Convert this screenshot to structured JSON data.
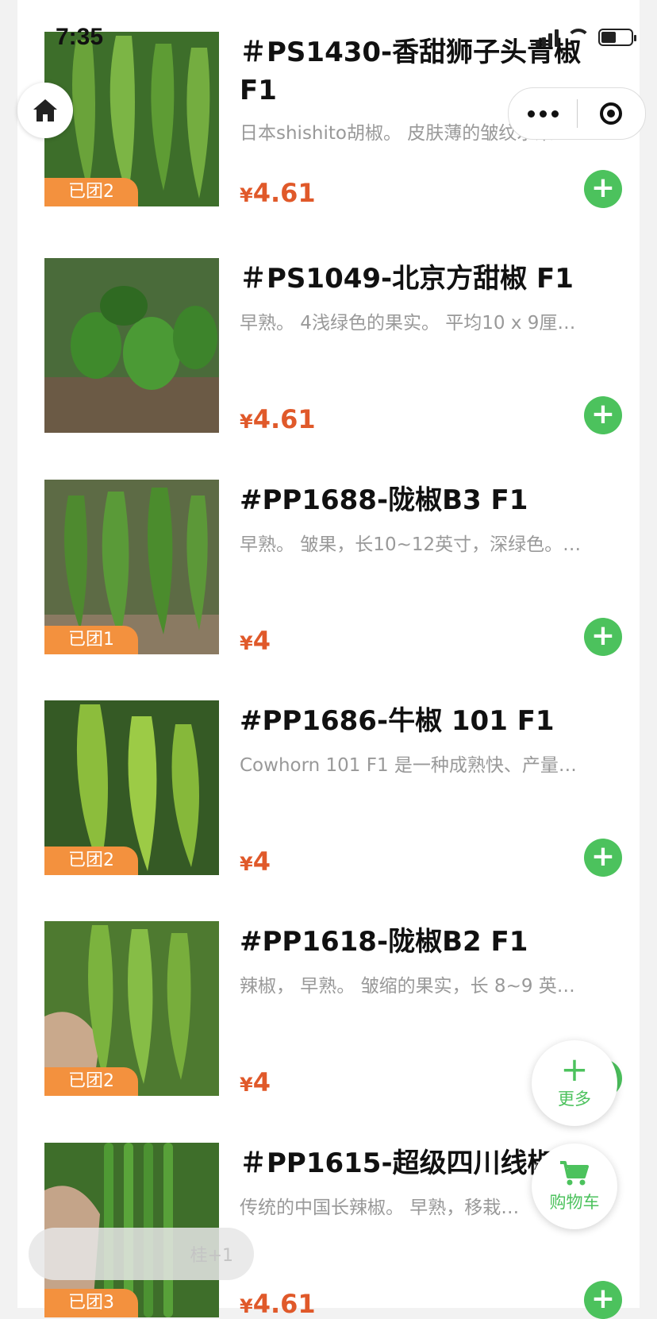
{
  "status_bar": {
    "time": "7:35",
    "battery_icon": "battery-charging-icon",
    "wifi_icon": "wifi-icon"
  },
  "nav": {
    "home_icon": "home-icon",
    "more_icon": "more-dots-icon",
    "close_icon": "target-icon"
  },
  "products": [
    {
      "title": "＃PS1430-香甜狮子头青椒 F1",
      "desc": "日本shishito胡椒。 皮肤薄的皱纹水果…",
      "price_symbol": "¥",
      "price_value": "4.61",
      "badge": "已团2"
    },
    {
      "title": "＃PS1049-北京方甜椒 F1",
      "desc": "早熟。 4浅绿色的果实。 平均10 x 9厘…",
      "price_symbol": "¥",
      "price_value": "4.61",
      "badge": ""
    },
    {
      "title": "#PP1688-陇椒B3 F1",
      "desc": "早熟。 皱果，长10~12英寸，深绿色。…",
      "price_symbol": "¥",
      "price_value": "4",
      "badge": "已团1"
    },
    {
      "title": "#PP1686-牛椒 101 F1",
      "desc": "Cowhorn 101 F1 是一种成熟快、产量…",
      "price_symbol": "¥",
      "price_value": "4",
      "badge": "已团2"
    },
    {
      "title": "#PP1618-陇椒B2 F1",
      "desc": "辣椒， 早熟。 皱缩的果实，长 8~9 英…",
      "price_symbol": "¥",
      "price_value": "4",
      "badge": "已团2"
    },
    {
      "title": "＃PP1615-超级四川线椒 F1",
      "desc": "传统的中国长辣椒。 早熟，移栽…",
      "price_symbol": "¥",
      "price_value": "4.61",
      "badge": "已团3"
    }
  ],
  "fab": {
    "more_label": "更多",
    "cart_label": "购物车"
  },
  "toast": {
    "text": "桂+1"
  },
  "colors": {
    "accent_green": "#4cc25d",
    "price_red": "#e0592a",
    "badge_orange": "#f3913e"
  }
}
